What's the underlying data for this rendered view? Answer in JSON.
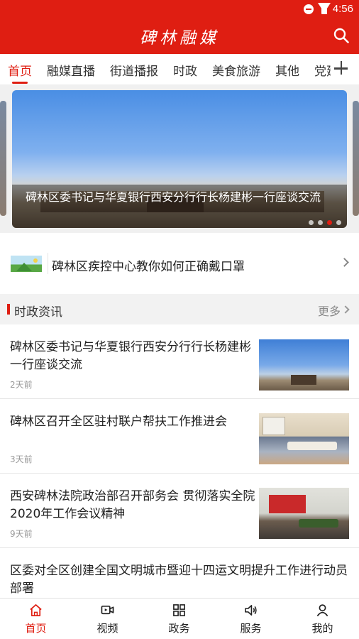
{
  "status_bar": {
    "time": "4:56"
  },
  "header": {
    "logo_text": "碑林融媒"
  },
  "tabs": [
    {
      "label": "首页",
      "active": true
    },
    {
      "label": "融媒直播",
      "active": false
    },
    {
      "label": "街道播报",
      "active": false
    },
    {
      "label": "时政",
      "active": false
    },
    {
      "label": "美食旅游",
      "active": false
    },
    {
      "label": "其他",
      "active": false
    },
    {
      "label": "党建",
      "active": false
    }
  ],
  "banner": {
    "caption": "碑林区委书记与华夏银行西安分行行长杨建彬一行座谈交流",
    "slide_count": 4,
    "active_slide": 3
  },
  "notice": {
    "text": "碑林区疾控中心教你如何正确戴口罩"
  },
  "section": {
    "title": "时政资讯",
    "more": "更多"
  },
  "news": [
    {
      "title": "碑林区委书记与华夏银行西安分行行长杨建彬一行座谈交流",
      "time": "2天前",
      "image": "city-gate-photo"
    },
    {
      "title": "碑林区召开全区驻村联户帮扶工作推进会",
      "time": "3天前",
      "image": "meeting-room-photo"
    },
    {
      "title": "西安碑林法院政治部召开部务会 贯彻落实全院2020年工作会议精神",
      "time": "9天前",
      "image": "conference-hall-photo"
    },
    {
      "title": "区委对全区创建全国文明城市暨迎十四运文明提升工作进行动员部署",
      "time": "",
      "image": ""
    }
  ],
  "bottom_nav": [
    {
      "label": "首页",
      "icon": "home-icon",
      "active": true
    },
    {
      "label": "视频",
      "icon": "video-icon",
      "active": false
    },
    {
      "label": "政务",
      "icon": "grid-icon",
      "active": false
    },
    {
      "label": "服务",
      "icon": "speaker-icon",
      "active": false
    },
    {
      "label": "我的",
      "icon": "user-icon",
      "active": false
    }
  ],
  "colors": {
    "brand_red": "#df1e12",
    "text": "#222222",
    "muted": "#999999",
    "section_bg": "#f2f2f2"
  }
}
